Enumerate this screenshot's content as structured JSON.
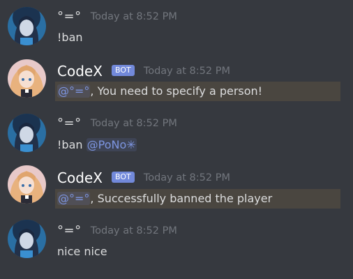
{
  "messages": [
    {
      "author": "°=°",
      "is_bot": false,
      "timestamp": "Today at 8:52 PM",
      "text": "!ban"
    },
    {
      "author": "CodeX",
      "is_bot": true,
      "bot_tag": "BOT",
      "timestamp": "Today at 8:52 PM",
      "mention": "@°=°",
      "text": ", You need to specify a person!"
    },
    {
      "author": "°=°",
      "is_bot": false,
      "timestamp": "Today at 8:52 PM",
      "text": "!ban ",
      "mention": "@PoNo✳"
    },
    {
      "author": "CodeX",
      "is_bot": true,
      "bot_tag": "BOT",
      "timestamp": "Today at 8:52 PM",
      "mention": "@°=°",
      "text": ", Successfully banned the player"
    },
    {
      "author": "°=°",
      "is_bot": false,
      "timestamp": "Today at 8:52 PM",
      "text": "nice nice"
    }
  ],
  "colors": {
    "background": "#36393f",
    "mention": "#7d95e0",
    "bot_tag": "#7289da",
    "highlight": "#4a4640",
    "timestamp": "#72767d"
  },
  "icons": {
    "user_avatar": "dark-haired-anime-avatar",
    "bot_avatar": "pink-haired-anime-avatar"
  }
}
